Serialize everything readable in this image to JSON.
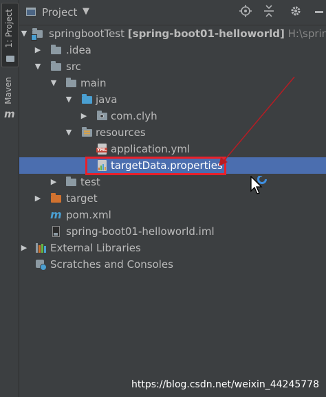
{
  "sidebar": {
    "project_tab": "1: Project",
    "maven_tab": "Maven"
  },
  "header": {
    "title": "Project",
    "caret": "▼"
  },
  "tree": {
    "root": {
      "name": "springbootTest",
      "module": "[spring-boot01-helloworld]",
      "path": "H:\\springbo"
    },
    "idea": ".idea",
    "src": "src",
    "main": "main",
    "java": "java",
    "package": "com.clyh",
    "resources": "resources",
    "application_yml": "application.yml",
    "target_data": "targetData.properties",
    "test": "test",
    "target": "target",
    "pom": "pom.xml",
    "iml": "spring-boot01-helloworld.iml",
    "external_libraries": "External Libraries",
    "scratches": "Scratches and Consoles"
  },
  "icons": {
    "yml_tag": "YML"
  },
  "colors": {
    "selection": "#4b6eaf",
    "annotation": "#e8202a",
    "folder_blue": "#4a9fd1",
    "folder_orange": "#d0722f"
  },
  "watermark": "https://blog.csdn.net/weixin_44245778"
}
